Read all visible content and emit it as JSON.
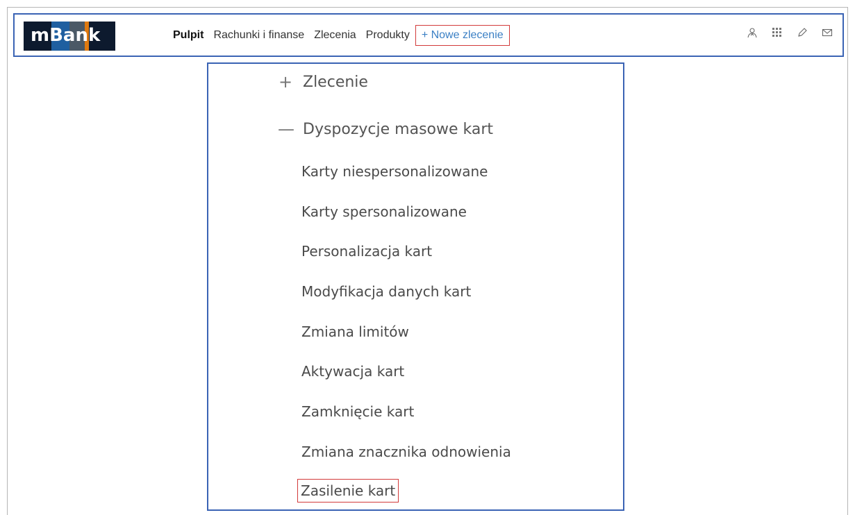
{
  "logo": {
    "text": "mBank"
  },
  "nav": {
    "items": [
      "Pulpit",
      "Rachunki i finanse",
      "Zlecenia",
      "Produkty"
    ],
    "new_order": "+ Nowe zlecenie"
  },
  "icons": [
    "user-icon",
    "apps-grid-icon",
    "pen-icon",
    "mail-icon"
  ],
  "menu": {
    "sections": [
      {
        "symbol": "+",
        "label": "Zlecenie"
      },
      {
        "symbol": "—",
        "label": "Dyspozycje masowe kart"
      }
    ],
    "items": [
      "Karty niespersonalizowane",
      "Karty spersonalizowane",
      "Personalizacja kart",
      "Modyfikacja danych kart",
      "Zmiana limitów",
      "Aktywacja kart",
      "Zamknięcie kart",
      "Zmiana znacznika odnowienia",
      "Zasilenie kart"
    ]
  },
  "colors": {
    "frame_border": "#3a63b4",
    "highlight_border": "#d23a3a",
    "link": "#3a7fc4",
    "logo_bg": "#0d1a2e"
  }
}
